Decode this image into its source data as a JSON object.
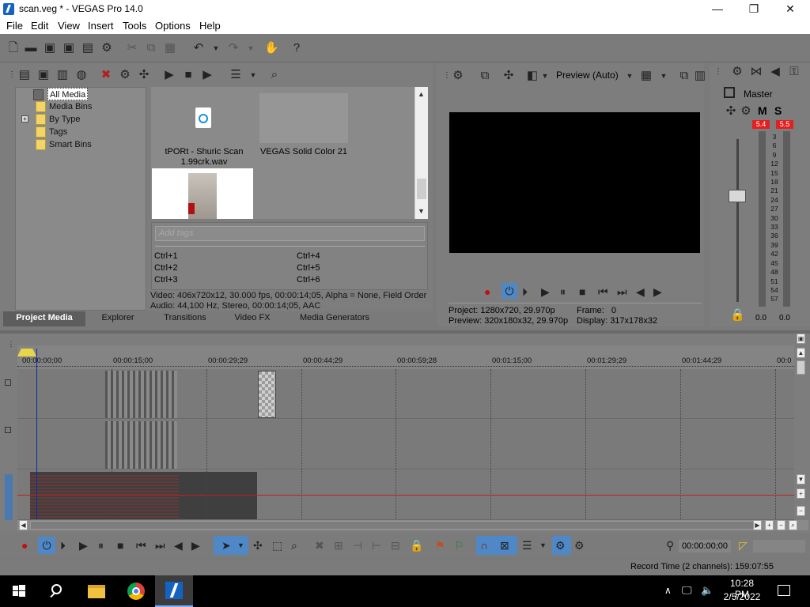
{
  "window": {
    "title": "scan.veg * - VEGAS Pro 14.0",
    "minimize": "—",
    "maximize": "❐",
    "close": "✕"
  },
  "menu": [
    "File",
    "Edit",
    "View",
    "Insert",
    "Tools",
    "Options",
    "Help"
  ],
  "project_media": {
    "tree": [
      "All Media",
      "Media Bins",
      "By Type",
      "Tags",
      "Smart Bins"
    ],
    "expander": "+",
    "items": [
      {
        "label": "tPORt - Shuric Scan 1.99crk.wav"
      },
      {
        "label": "VEGAS Solid Color 21"
      }
    ],
    "tags_placeholder": "Add tags",
    "shortcuts_left": [
      "Ctrl+1",
      "Ctrl+2",
      "Ctrl+3"
    ],
    "shortcuts_right": [
      "Ctrl+4",
      "Ctrl+5",
      "Ctrl+6"
    ],
    "info_video": "Video: 406x720x12, 30.000 fps, 00:00:14;05, Alpha = None, Field Order",
    "info_audio": "Audio: 44,100 Hz, Stereo, 00:00:14;05, AAC"
  },
  "tabs": [
    "Project Media",
    "Explorer",
    "Transitions",
    "Video FX",
    "Media Generators"
  ],
  "preview": {
    "mode": "Preview (Auto)",
    "project_label": "Project:",
    "project_value": "1280x720, 29.970p",
    "preview_label": "Preview:",
    "preview_value": "320x180x32, 29.970p",
    "frame_label": "Frame:",
    "frame_value": "0",
    "display_label": "Display:",
    "display_value": "317x178x32"
  },
  "master": {
    "title": "Master",
    "m": "M",
    "s": "S",
    "peak_left": "5.4",
    "peak_right": "5.5",
    "scale": [
      "3",
      "6",
      "9",
      "12",
      "15",
      "18",
      "21",
      "24",
      "27",
      "30",
      "33",
      "36",
      "39",
      "42",
      "45",
      "48",
      "51",
      "54",
      "57"
    ],
    "left_value": "0.0",
    "right_value": "0.0"
  },
  "timeline": {
    "ticks": [
      "00:00:00;00",
      "00:00:15;00",
      "00:00:29;29",
      "00:00:44;29",
      "00:00:59;28",
      "00:01:15;00",
      "00:01:29;29",
      "00:01:44;29",
      "00:0"
    ]
  },
  "transport": {
    "time": "00:00:00;00"
  },
  "status": {
    "record_time": "Record Time (2 channels): 159:07:55"
  },
  "taskbar": {
    "time": "10:28 PM",
    "date": "2/5/2022"
  },
  "colors": {
    "accent": "#1463c3",
    "panel": "#7d7d7d",
    "peak": "#e32020",
    "cursor": "#0a2ea8"
  }
}
